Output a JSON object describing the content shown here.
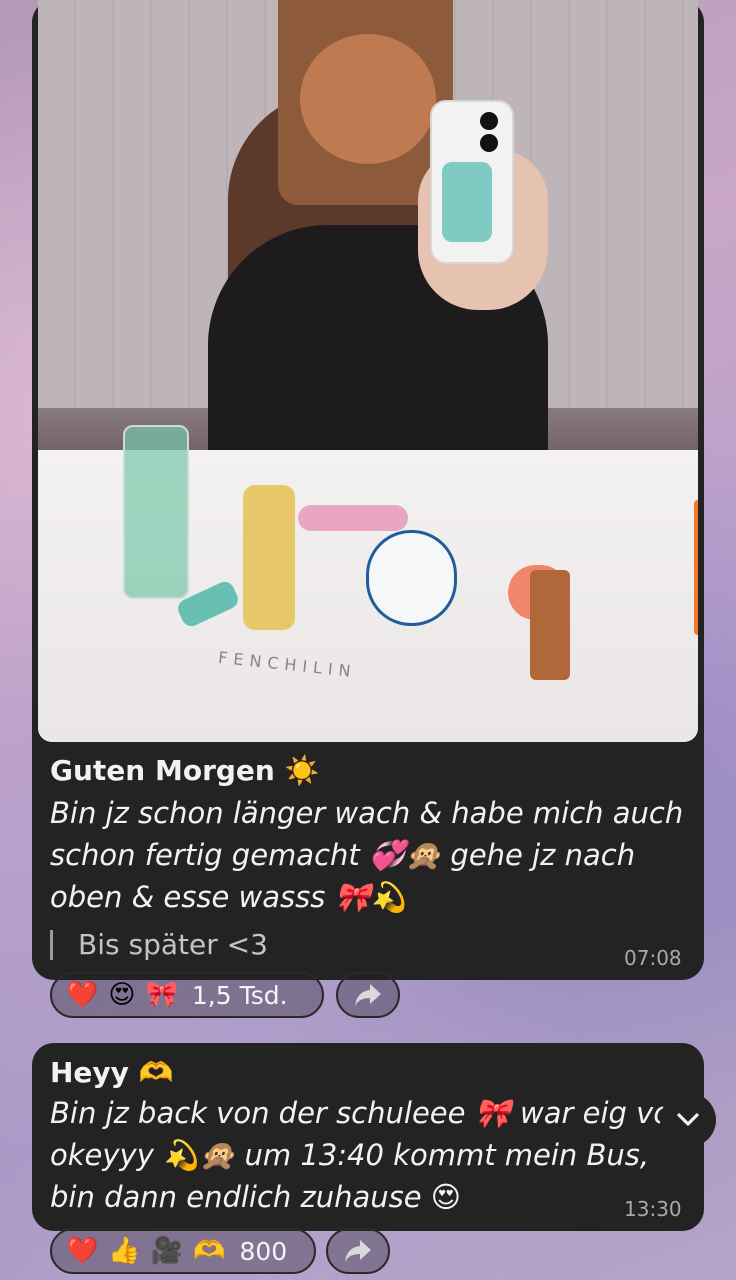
{
  "messages": [
    {
      "title": "Guten Morgen ☀️",
      "lines": [
        "Bin jz schon länger wach & habe mich auch",
        "schon fertig gemacht 💞🙊 gehe jz nach",
        "oben & esse wasss 🎀💫"
      ],
      "quote": "Bis später <3",
      "time": "07:08",
      "photo_caption": "FENCHILIN",
      "reactions": [
        "❤️",
        "😍",
        "🎀"
      ],
      "reaction_count": "1,5 Tsd."
    },
    {
      "title": "Heyy 🫶",
      "lines": [
        "Bin jz back von der schuleee 🎀 war eig vo",
        "okeyyy 💫🙊 um 13:40 kommt mein Bus,",
        "bin dann endlich zuhause 😍"
      ],
      "time": "13:30",
      "reactions": [
        "❤️",
        "👍",
        "🎥",
        "🫶"
      ],
      "reaction_count": "800"
    }
  ],
  "icons": {
    "share": "share-arrow-icon",
    "chevron": "chevron-down-icon"
  },
  "colors": {
    "bubble": "#232323",
    "text": "#f2f2f2",
    "muted": "#a9a9a9"
  }
}
